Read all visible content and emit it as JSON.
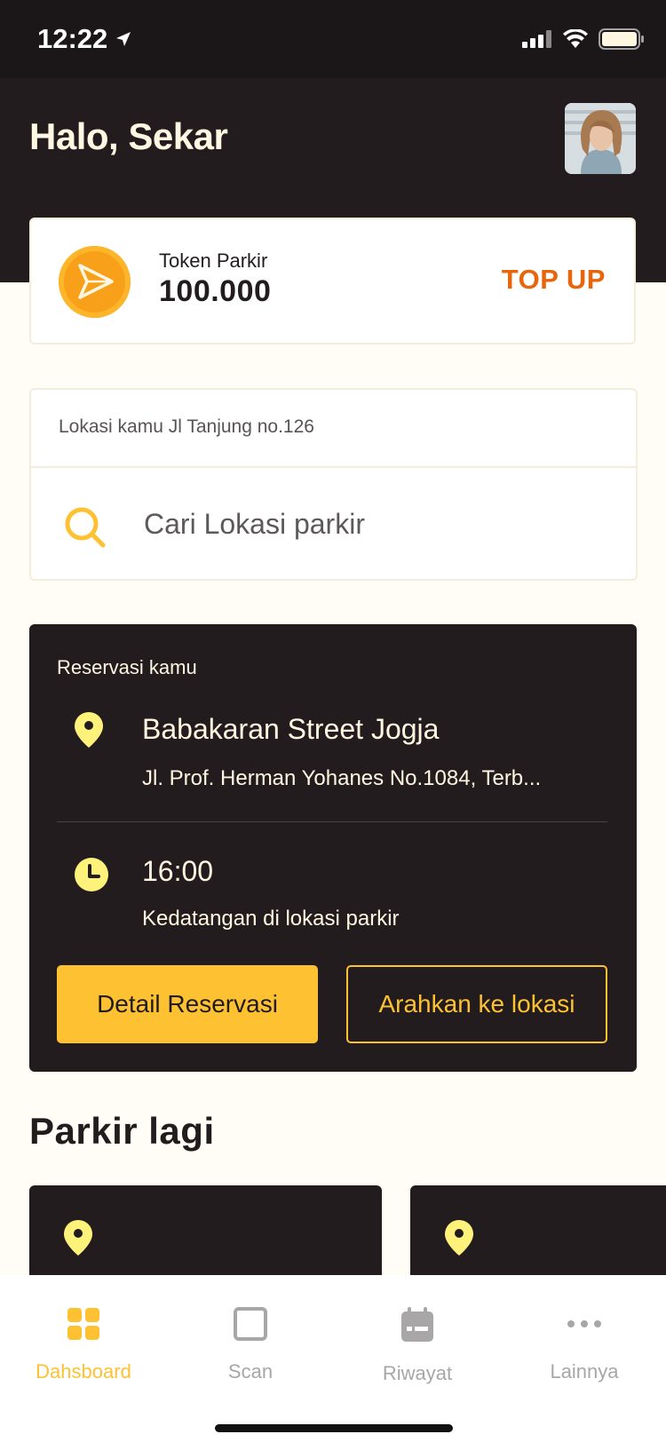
{
  "status_bar": {
    "time": "12:22"
  },
  "header": {
    "greeting": "Halo, Sekar"
  },
  "token": {
    "label": "Token Parkir",
    "value": "100.000",
    "topup_label": "TOP UP"
  },
  "search": {
    "location_text": "Lokasi kamu Jl Tanjung no.126",
    "placeholder": "Cari Lokasi parkir"
  },
  "reservation": {
    "title": "Reservasi kamu",
    "place": "Babakaran Street Jogja",
    "address": "Jl. Prof. Herman Yohanes No.1084, Terb...",
    "time": "16:00",
    "time_label": "Kedatangan di lokasi parkir",
    "detail_button": "Detail Reservasi",
    "direction_button": "Arahkan ke lokasi"
  },
  "parkir_lagi": {
    "title": "Parkir lagi"
  },
  "nav": {
    "items": [
      {
        "label": "Dahsboard",
        "icon": "dashboard-icon",
        "active": true
      },
      {
        "label": "Scan",
        "icon": "scan-icon",
        "active": false
      },
      {
        "label": "Riwayat",
        "icon": "calendar-icon",
        "active": false
      },
      {
        "label": "Lainnya",
        "icon": "more-icon",
        "active": false
      }
    ]
  },
  "colors": {
    "dark": "#231C1E",
    "accent": "#FDC132",
    "topup": "#E8650B",
    "pin": "#FFF27A",
    "background": "#FFFDF6"
  }
}
